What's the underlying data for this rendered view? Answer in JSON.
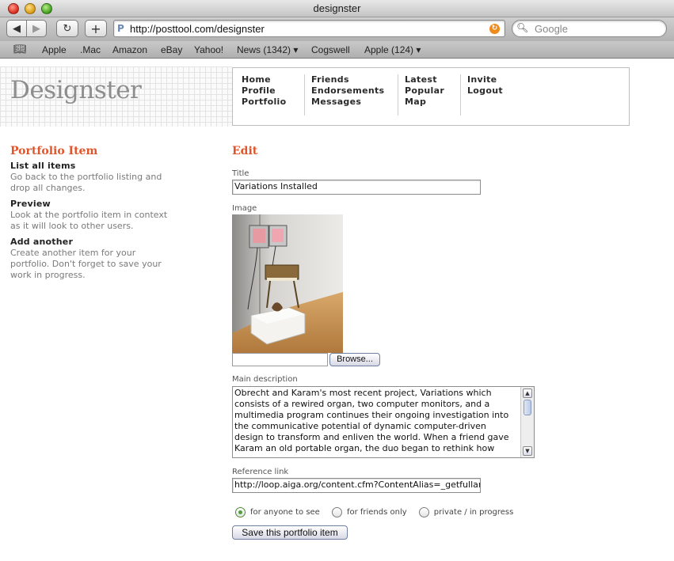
{
  "window": {
    "title": "designster"
  },
  "toolbar": {
    "back_label": "◀",
    "forward_label": "▶",
    "reload_label": "↻",
    "add_label": "+",
    "url": "http://posttool.com/designster",
    "search_placeholder": "Google"
  },
  "bookmarks": [
    "Apple",
    ".Mac",
    "Amazon",
    "eBay",
    "Yahoo!",
    "News (1342) ▾",
    "Cogswell",
    "Apple (124) ▾"
  ],
  "site": {
    "logo": "Designster"
  },
  "nav": {
    "col1": [
      "Home",
      "Profile",
      "Portfolio"
    ],
    "col2": [
      "Friends",
      "Endorsements",
      "Messages"
    ],
    "col3": [
      "Latest",
      "Popular",
      "Map"
    ],
    "col4": [
      "Invite",
      "Logout"
    ]
  },
  "sidebar": {
    "title": "Portfolio Item",
    "items": [
      {
        "heading": "List all items",
        "desc": "Go back to the portfolio listing and drop all changes."
      },
      {
        "heading": "Preview",
        "desc": "Look at the portfolio item in context as it will look to other users."
      },
      {
        "heading": "Add another",
        "desc": "Create another item for your portfolio. Don't forget to save your work in progress."
      }
    ]
  },
  "form": {
    "heading": "Edit",
    "title_label": "Title",
    "title_value": "Variations Installed",
    "image_label": "Image",
    "browse_label": "Browse...",
    "description_label": "Main description",
    "description_value": "Obrecht and Karam's most recent project, Variations  which consists of a rewired organ, two computer monitors, and a multimedia program  continues their ongoing investigation into the communicative potential of dynamic computer-driven design to transform and enliven the world. When a friend gave Karam an old portable organ, the duo began to rethink how",
    "reference_label": "Reference link",
    "reference_value": "http://loop.aiga.org/content.cfm?ContentAlias=_getfullar",
    "visibility_options": [
      "for anyone to see",
      "for friends only",
      "private / in progress"
    ],
    "visibility_selected": "for anyone to see",
    "save_label": "Save this portfolio item"
  },
  "colors": {
    "accent": "#e0552b",
    "radio_selected": "#4ea03a"
  }
}
